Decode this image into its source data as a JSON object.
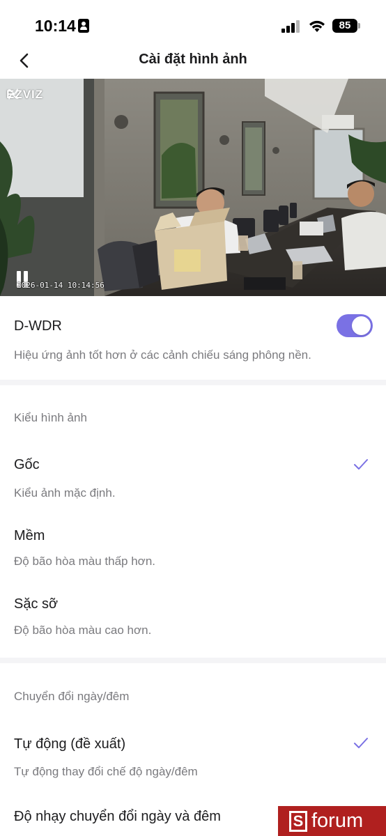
{
  "status_bar": {
    "time": "10:14",
    "battery": "85"
  },
  "nav": {
    "title": "Cài đặt hình ảnh"
  },
  "preview": {
    "brand": "EZVIZ",
    "timestamp": "2026-01-14 10:14:56"
  },
  "wdr": {
    "title": "D-WDR",
    "description": "Hiệu ứng ảnh tốt hơn ở các cảnh chiếu sáng phông nền.",
    "enabled": true,
    "accent_color": "#7a71e4"
  },
  "image_style": {
    "section_label": "Kiểu hình ảnh",
    "options": [
      {
        "title": "Gốc",
        "description": "Kiểu ảnh mặc định.",
        "selected": true
      },
      {
        "title": "Mềm",
        "description": "Độ bão hòa màu thấp hơn.",
        "selected": false
      },
      {
        "title": "Sặc sỡ",
        "description": "Độ bão hòa màu cao hơn.",
        "selected": false
      }
    ]
  },
  "day_night": {
    "section_label": "Chuyển đổi ngày/đêm",
    "options": [
      {
        "title": "Tự động (đề xuất)",
        "description": "Tự động thay đổi chế độ ngày/đêm",
        "selected": true
      }
    ],
    "sensitivity_title": "Độ nhạy chuyển đổi ngày và đêm"
  },
  "watermark": {
    "letter": "S",
    "text": "forum"
  },
  "icons": {
    "back": "chevron-left-icon",
    "check": "checkmark-icon",
    "pause": "pause-icon"
  }
}
